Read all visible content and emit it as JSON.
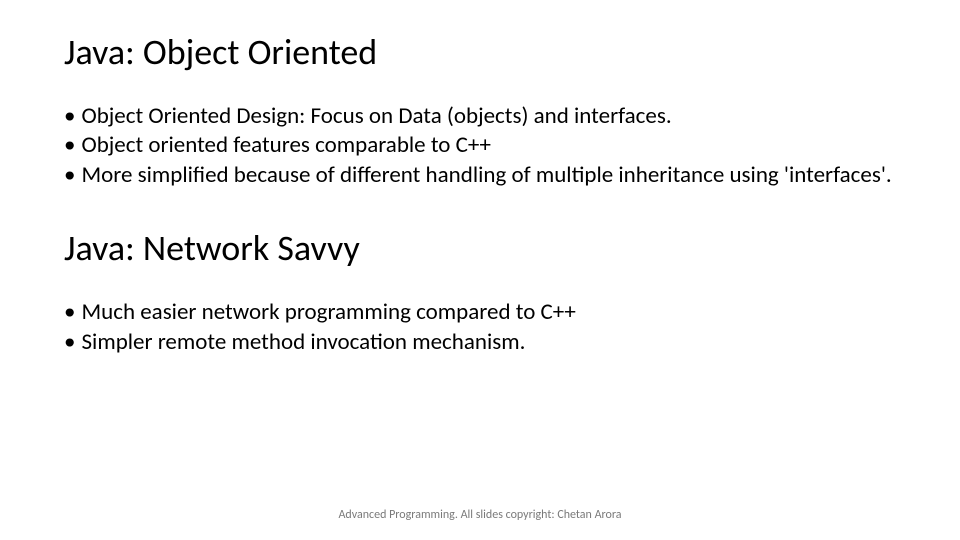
{
  "section1": {
    "heading": "Java: Object Oriented",
    "bullets": [
      "Object Oriented Design: Focus on Data (objects) and interfaces.",
      "Object oriented features comparable to C++",
      "More simplified because of different handling of multiple inheritance using 'interfaces'."
    ]
  },
  "section2": {
    "heading": "Java: Network Savvy",
    "bullets": [
      "Much easier network programming compared to C++",
      "Simpler remote method invocation mechanism."
    ]
  },
  "footer": "Advanced Programming. All slides copyright: Chetan Arora",
  "bullet_char": "•"
}
